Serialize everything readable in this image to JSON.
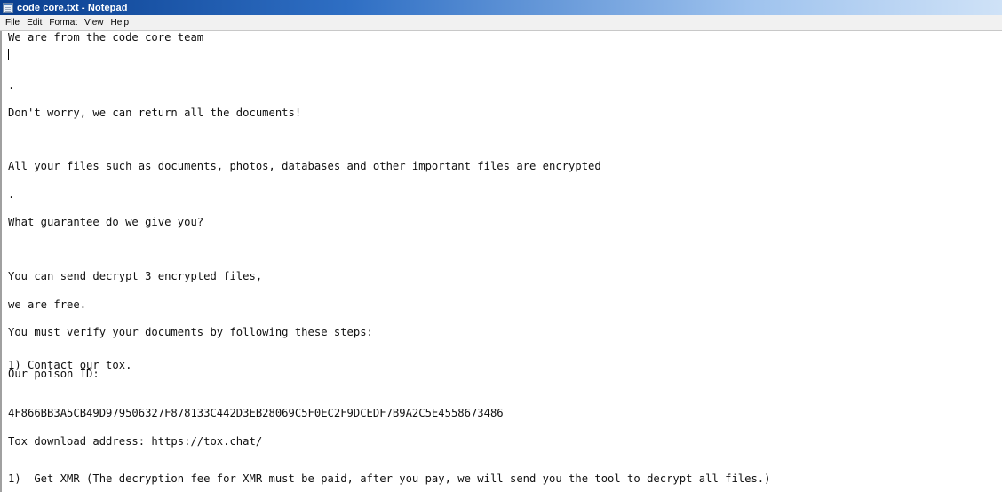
{
  "window": {
    "title": "code core.txt - Notepad"
  },
  "menu": {
    "items": [
      "File",
      "Edit",
      "Format",
      "View",
      "Help"
    ]
  },
  "document": {
    "lines": [
      "We are from the code core team",
      ".",
      "Don't worry, we can return all the documents!",
      "All your files such as documents, photos, databases and other important files are encrypted",
      ".",
      "What guarantee do we give you?",
      "You can send decrypt 3 encrypted files,",
      "we are free.",
      "You must verify your documents by following these steps:",
      "1) Contact our tox.",
      "Our poison ID:",
      "4F866BB3A5CB49D979506327F878133C442D3EB28069C5F0EC2F9DCEDF7B9A2C5E4558673486",
      "Tox download address: https://tox.chat/",
      "1)  Get XMR (The decryption fee for XMR must be paid, after you pay, we will send you the tool to decrypt all files.)"
    ]
  },
  "colors": {
    "titlebar_start": "#0a3f8f",
    "titlebar_end": "#cfe2f7",
    "text": "#111111"
  }
}
